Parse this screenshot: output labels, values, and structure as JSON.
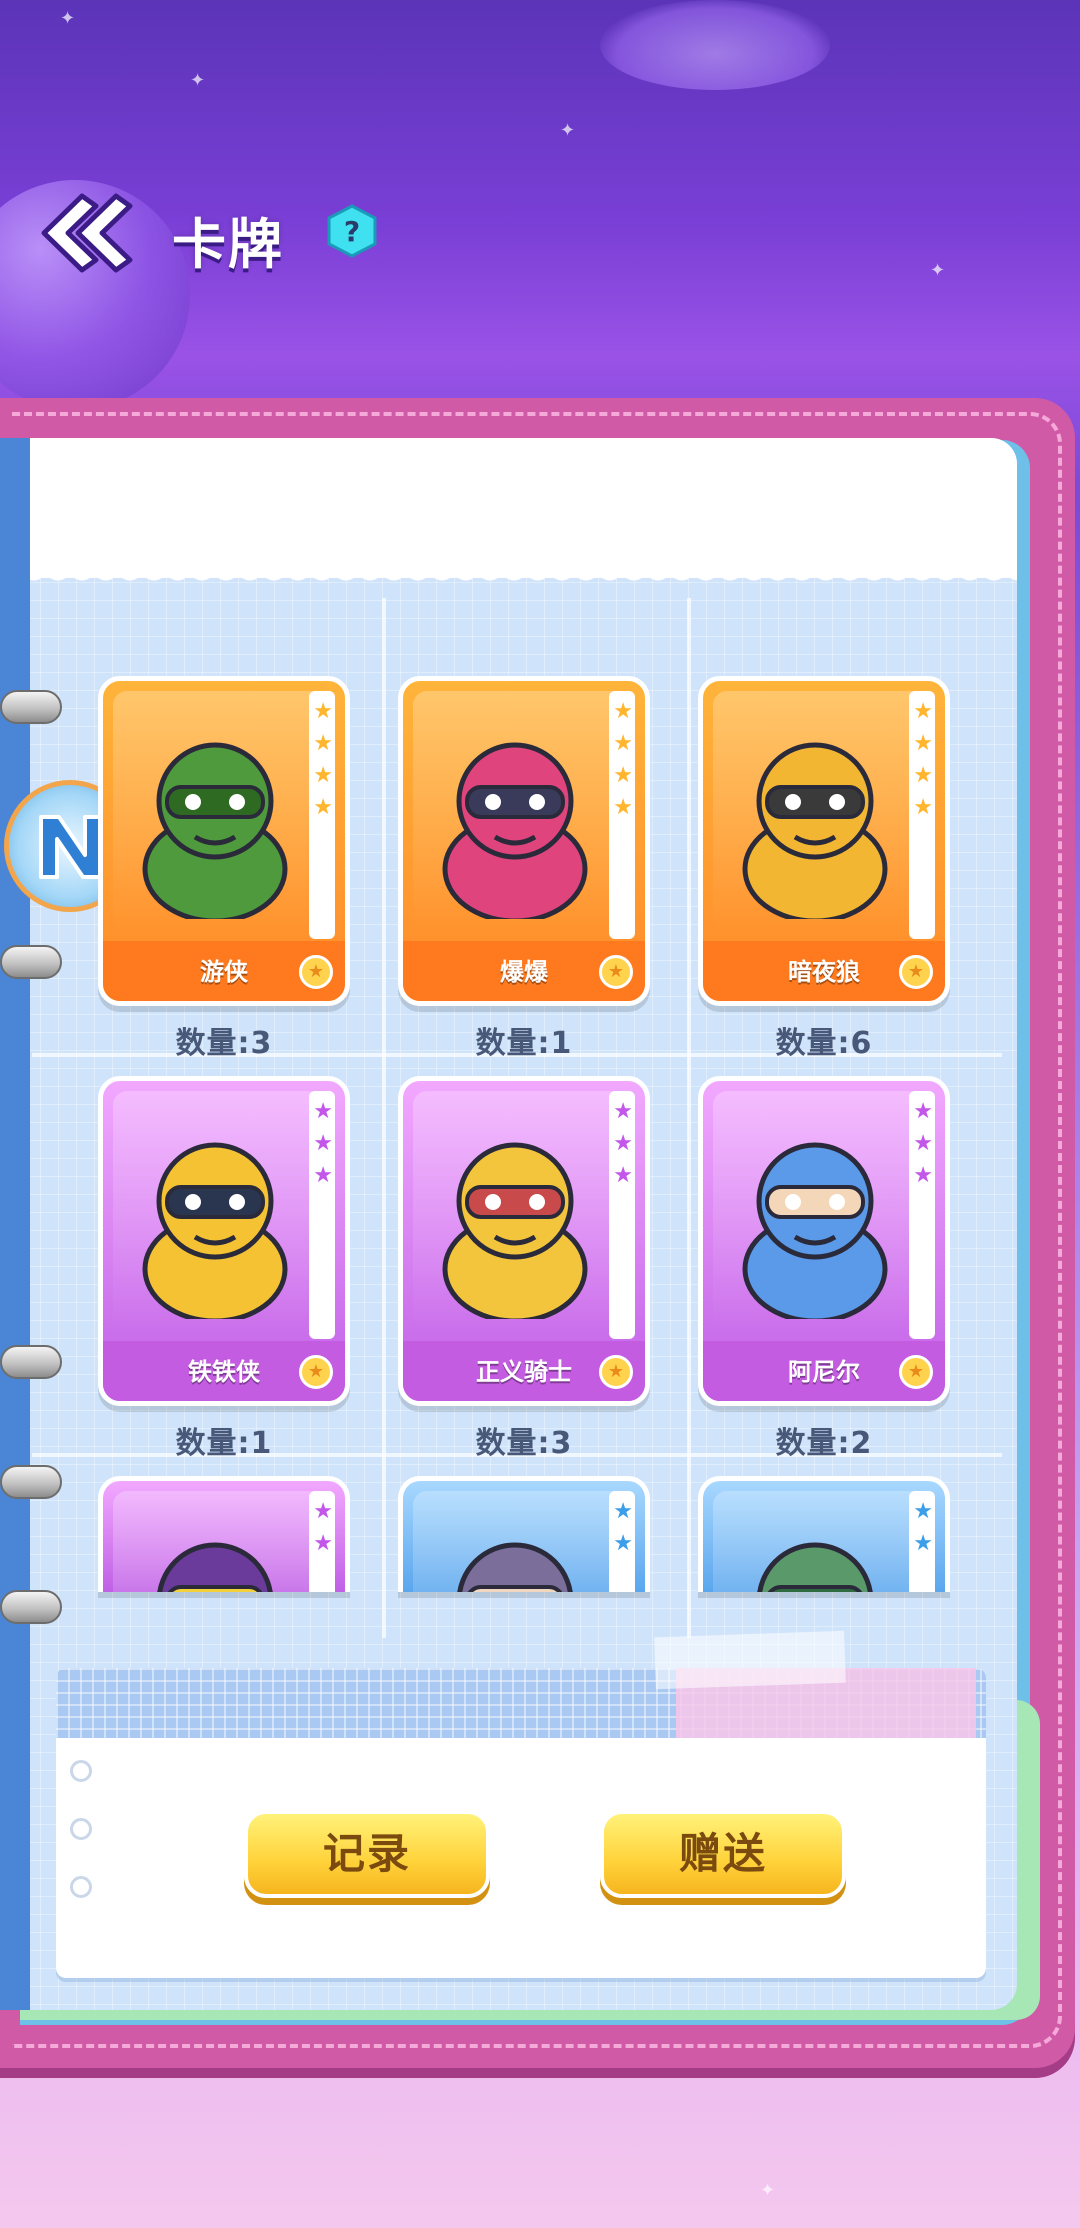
{
  "header": {
    "back_icon": "double-chevron-left-icon",
    "title": "卡牌",
    "help_icon": "question-hex-icon",
    "help_label": "?"
  },
  "cards": [
    {
      "name": "游侠",
      "count": "数量:3",
      "rarity_color": "orange",
      "stars": 4
    },
    {
      "name": "爆爆",
      "count": "数量:1",
      "rarity_color": "orange",
      "stars": 4
    },
    {
      "name": "暗夜狼",
      "count": "数量:6",
      "rarity_color": "orange",
      "stars": 4
    },
    {
      "name": "铁铁侠",
      "count": "数量:1",
      "rarity_color": "purple",
      "stars": 3
    },
    {
      "name": "正义骑士",
      "count": "数量:3",
      "rarity_color": "purple",
      "stars": 3
    },
    {
      "name": "阿尼尔",
      "count": "数量:2",
      "rarity_color": "purple",
      "stars": 3
    },
    {
      "name": "",
      "count": "",
      "rarity_color": "purple",
      "stars": 2
    },
    {
      "name": "",
      "count": "",
      "rarity_color": "blue",
      "stars": 2
    },
    {
      "name": "",
      "count": "",
      "rarity_color": "blue",
      "stars": 2
    }
  ],
  "actions": {
    "record_label": "记录",
    "gift_label": "赠送"
  },
  "colors": {
    "orange_card": "#ff8a2a",
    "purple_card": "#c060e6",
    "blue_card": "#5aa6ee",
    "button_yellow": "#ffd23a",
    "book_pink": "#d15aa7"
  }
}
